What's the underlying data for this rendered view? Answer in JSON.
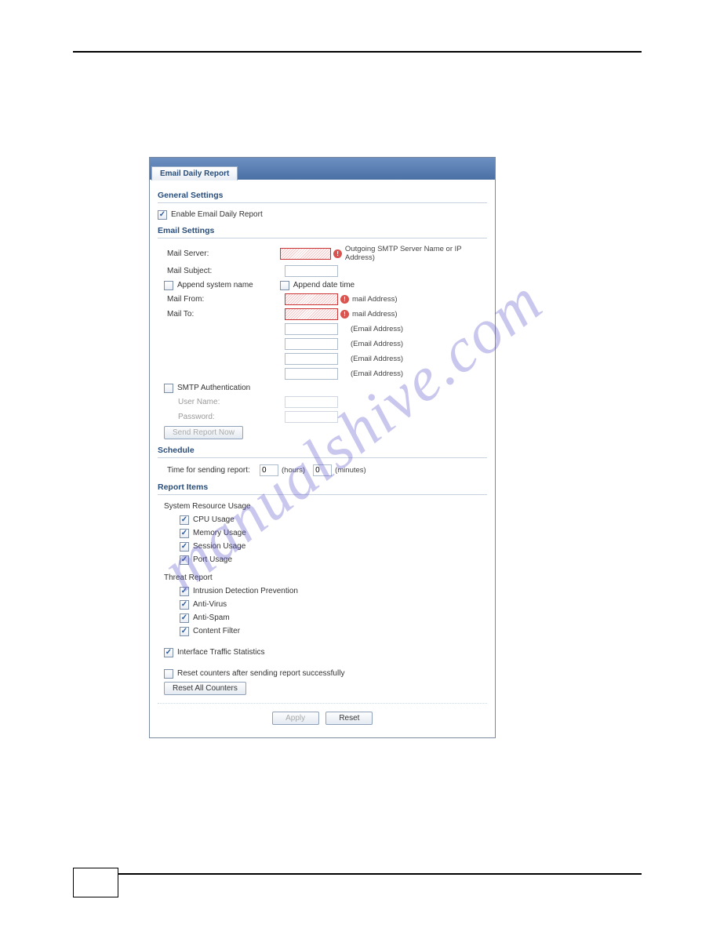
{
  "watermark": "manualshive.com",
  "tab_title": "Email Daily Report",
  "sections": {
    "general": {
      "title": "General Settings",
      "enable_label": "Enable Email Daily Report"
    },
    "email": {
      "title": "Email Settings",
      "mail_server_label": "Mail Server:",
      "mail_server_hint": "Outgoing SMTP Server Name or IP Address)",
      "mail_subject_label": "Mail Subject:",
      "append_sys_label": "Append system name",
      "append_dt_label": "Append date time",
      "mail_from_label": "Mail From:",
      "mail_to_label": "Mail To:",
      "email_addr_hint_req": "mail Address)",
      "email_addr_hint": "(Email Address)",
      "smtp_auth_label": "SMTP Authentication",
      "username_label": "User Name:",
      "password_label": "Password:",
      "send_now_btn": "Send Report Now"
    },
    "schedule": {
      "title": "Schedule",
      "time_label": "Time for sending report:",
      "hours_value": "0",
      "hours_label": "(hours)",
      "minutes_value": "0",
      "minutes_label": "(minutes)"
    },
    "report": {
      "title": "Report Items",
      "sys_res_label": "System Resource Usage",
      "cpu_label": "CPU Usage",
      "memory_label": "Memory Usage",
      "session_label": "Session Usage",
      "port_label": "Port Usage",
      "threat_label": "Threat Report",
      "idp_label": "Intrusion Detection Prevention",
      "av_label": "Anti-Virus",
      "as_label": "Anti-Spam",
      "cf_label": "Content Filter",
      "its_label": "Interface Traffic Statistics",
      "reset_counters_label": "Reset counters after sending report successfully",
      "reset_all_btn": "Reset All Counters"
    }
  },
  "footer": {
    "apply": "Apply",
    "reset": "Reset"
  }
}
